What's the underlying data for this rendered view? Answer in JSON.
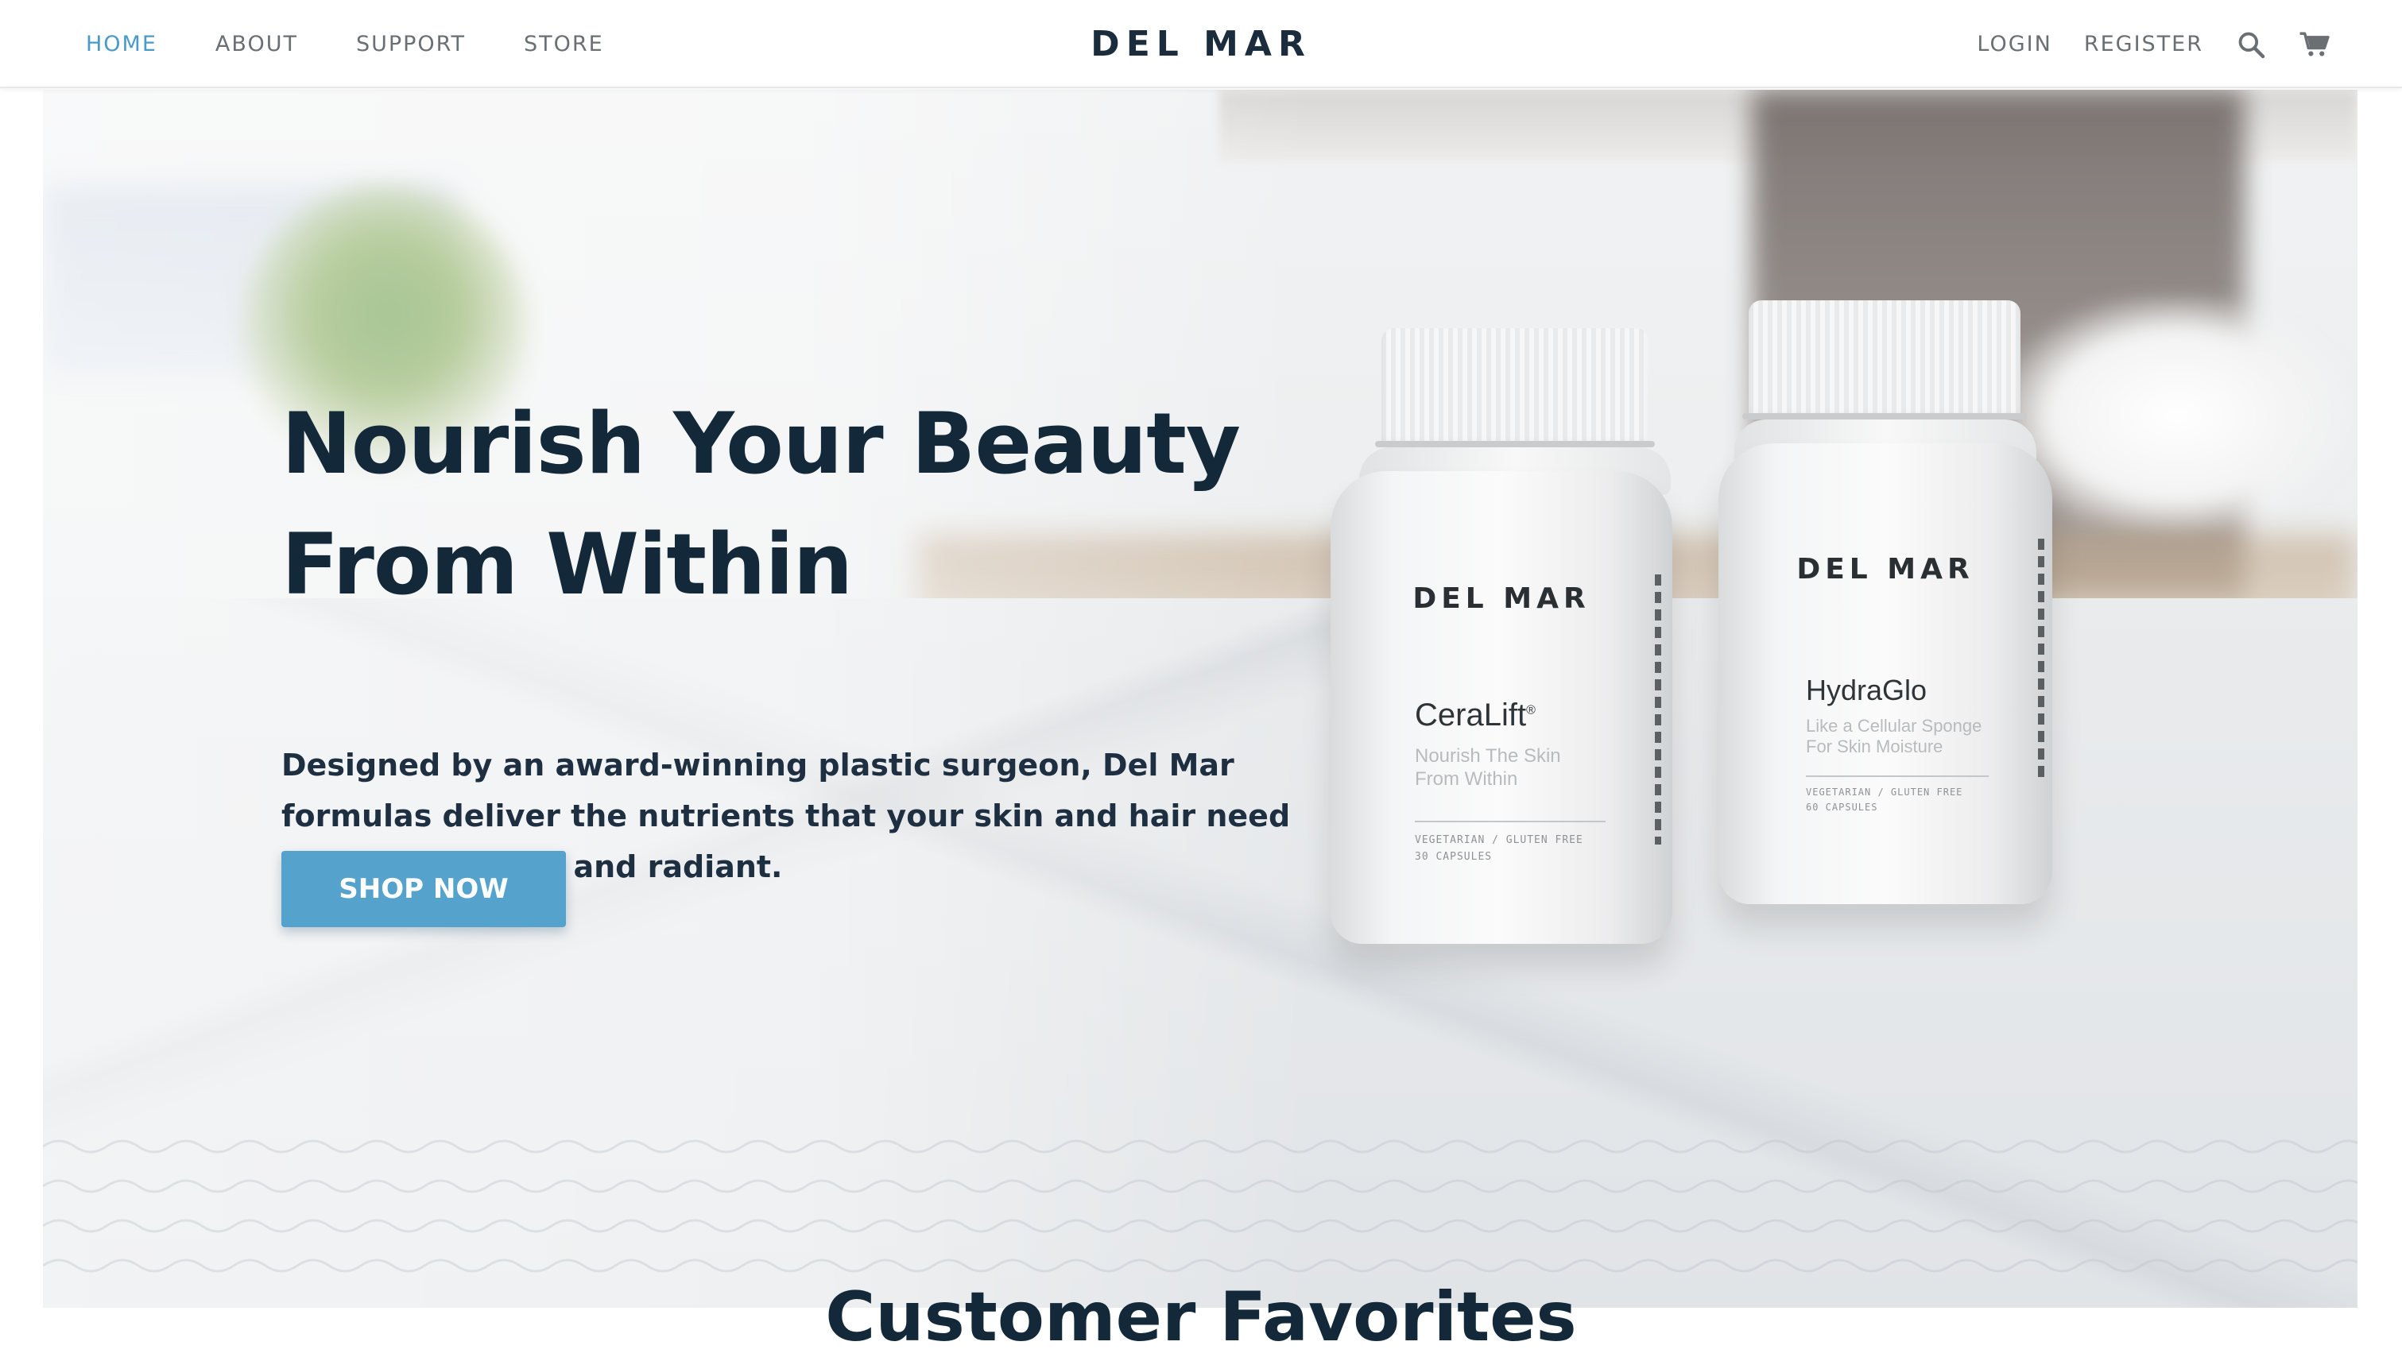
{
  "header": {
    "nav_left": [
      {
        "label": "HOME",
        "active": true
      },
      {
        "label": "ABOUT",
        "active": false
      },
      {
        "label": "SUPPORT",
        "active": false
      },
      {
        "label": "STORE",
        "active": false
      }
    ],
    "logo": "DEL MAR",
    "nav_right": [
      {
        "label": "LOGIN"
      },
      {
        "label": "REGISTER"
      }
    ],
    "icons": [
      "search-icon",
      "cart-icon"
    ]
  },
  "hero": {
    "title_line1": "Nourish Your Beauty",
    "title_line2": "From Within",
    "description": "Designed by an award-winning plastic surgeon, Del Mar formulas deliver the nutrients that your skin and hair need to stay beautiful and radiant.",
    "cta_label": "SHOP NOW"
  },
  "products": [
    {
      "brand": "DEL MAR",
      "name": "CeraLift",
      "mark": "®",
      "tagline_1": "Nourish The Skin",
      "tagline_2": "From Within",
      "meta_1": "VEGETARIAN / GLUTEN FREE",
      "meta_2": "30 CAPSULES"
    },
    {
      "brand": "DEL MAR",
      "name": "HydraGlo",
      "tagline_1": "Like a Cellular Sponge",
      "tagline_2": "For Skin Moisture",
      "meta_1": "VEGETARIAN / GLUTEN FREE",
      "meta_2": "60 CAPSULES"
    }
  ],
  "sections": {
    "favorites_heading": "Customer Favorites"
  },
  "colors": {
    "accent": "#55a3cd",
    "nav_active": "#4a9ac9",
    "heading": "#13293a",
    "nav_text": "#6a6f74"
  }
}
